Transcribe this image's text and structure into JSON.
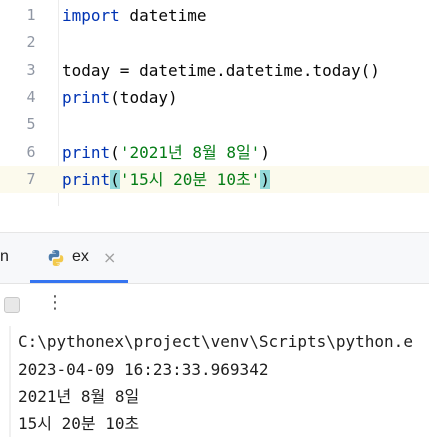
{
  "editor": {
    "lines": [
      {
        "num": "1",
        "parts": [
          {
            "t": "import",
            "c": "kw"
          },
          {
            "t": " datetime",
            "c": ""
          }
        ]
      },
      {
        "num": "2",
        "parts": []
      },
      {
        "num": "3",
        "parts": [
          {
            "t": "today = datetime.datetime.today()",
            "c": ""
          }
        ]
      },
      {
        "num": "4",
        "parts": [
          {
            "t": "print",
            "c": "fn"
          },
          {
            "t": "(today)",
            "c": ""
          }
        ]
      },
      {
        "num": "5",
        "parts": []
      },
      {
        "num": "6",
        "parts": [
          {
            "t": "print",
            "c": "fn"
          },
          {
            "t": "(",
            "c": ""
          },
          {
            "t": "'2021년 8월 8일'",
            "c": "str"
          },
          {
            "t": ")",
            "c": ""
          }
        ]
      },
      {
        "num": "7",
        "parts": [
          {
            "t": "print",
            "c": "fn"
          },
          {
            "t": "(",
            "c": "paren-hl"
          },
          {
            "t": "'15시 20분 10초'",
            "c": "str"
          },
          {
            "t": ")",
            "c": "paren-hl"
          }
        ],
        "current": true
      }
    ]
  },
  "run_panel": {
    "partial_label": "n",
    "tab_label": "ex",
    "tab_close": "×",
    "more_actions": "⋮"
  },
  "console": {
    "lines": [
      "C:\\pythonex\\project\\venv\\Scripts\\python.e",
      "2023-04-09 16:23:33.969342",
      "2021년 8월 8일",
      "15시 20분 10초"
    ]
  },
  "colors": {
    "keyword": "#0033b3",
    "string": "#067d17",
    "tab_accent": "#3574f0",
    "current_line": "#fcfaed"
  }
}
